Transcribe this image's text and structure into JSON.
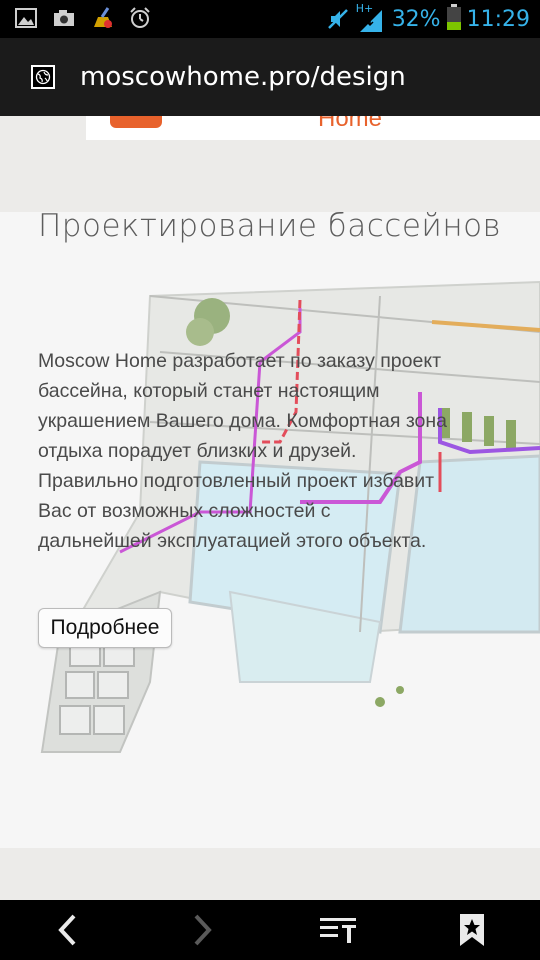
{
  "status_bar": {
    "icons_left": [
      "gallery-icon",
      "camera-icon",
      "broom-icon",
      "alarm-icon"
    ],
    "network_label": "H+",
    "battery_percent": "32%",
    "battery_level": 0.32,
    "time": "11:29",
    "accent_color": "#36b3ea"
  },
  "browser": {
    "url": "moscowhome.pro/design",
    "site_icon": "globe-icon"
  },
  "page": {
    "header_logo_text": "Home",
    "section_title": "Проектирование бассейнов",
    "description": "Moscow Home разработает по заказу проект бассейна, который станет настоящим украшением Вашего дома. Комфортная зона отдыха порадует близких и друзей. Правильно подготовленный проект избавит Вас от возможных сложностей с дальнейшей эксплуатацией этого объекта.",
    "more_button_label": "Подробнее",
    "illustration": "pool-plan-illustration"
  },
  "toolbar": {
    "back_icon": "back-icon",
    "forward_icon": "forward-icon",
    "reader_icon": "reader-mode-icon",
    "bookmark_icon": "bookmark-icon"
  }
}
